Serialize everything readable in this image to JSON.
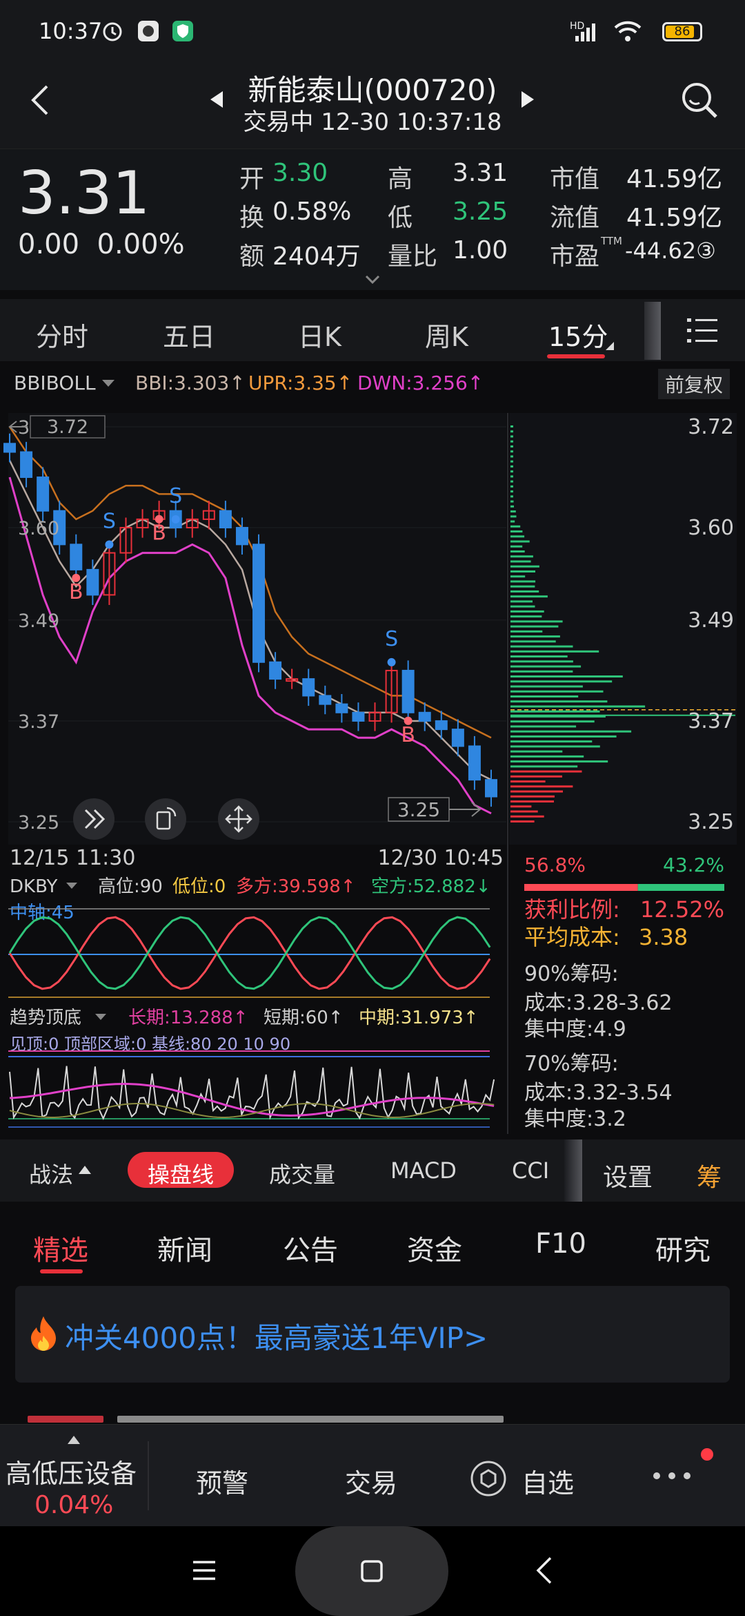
{
  "status": {
    "time": "10:37",
    "battery": "86",
    "battery_level": 0.86,
    "net_label": "HD"
  },
  "header": {
    "title": "新能泰山(000720)",
    "subtitle": "交易中   12-30 10:37:18"
  },
  "quote": {
    "price": "3.31",
    "change": "0.00",
    "change_pct": "0.00%",
    "open_label": "开",
    "open": "3.30",
    "high_label": "高",
    "high": "3.31",
    "mcap_label": "市值",
    "mcap": "41.59亿",
    "turnover_label": "换",
    "turnover": "0.58%",
    "low_label": "低",
    "low": "3.25",
    "float_label": "流值",
    "float_cap": "41.59亿",
    "amount_label": "额",
    "amount": "2404万",
    "volratio_label": "量比",
    "volratio": "1.00",
    "pe_label": "市盈",
    "pe_sup": "TTM",
    "pe": "-44.62③"
  },
  "tabs": [
    "分时",
    "五日",
    "日K",
    "周K",
    "15分"
  ],
  "active_tab": "15分",
  "indicator_main": {
    "name": "BBIBOLL",
    "bbi": "BBI:3.303↑",
    "upr": "UPR:3.35↑",
    "dwn": "DWN:3.256↑",
    "adjust": "前复权"
  },
  "main_chart": {
    "y_ticks": [
      "3.72",
      "3.60",
      "3.49",
      "3.37",
      "3.25"
    ],
    "ymax_box": "3.72",
    "ymin_box": "3.25",
    "x_start": "12/15 11:30",
    "x_end": "12/30 10:45",
    "marker_s": "S",
    "marker_b": "B"
  },
  "chips": {
    "profit_pct": "56.8%",
    "loss_pct": "43.2%",
    "profit_ratio_label": "获利比例:",
    "profit_ratio": "12.52%",
    "avg_cost_label": "平均成本:",
    "avg_cost": "3.38",
    "chip90_label": "90%筹码:",
    "chip90_cost": "成本:3.28-3.62",
    "chip90_conc": "集中度:4.9",
    "chip70_label": "70%筹码:",
    "chip70_cost": "成本:3.32-3.54",
    "chip70_conc": "集中度:3.2"
  },
  "dkby": {
    "name": "DKBY",
    "high": "高位:90",
    "low": "低位:0",
    "bull": "多方:39.598↑",
    "bear": "空方:52.882↓",
    "axis": "中轴:45"
  },
  "trend": {
    "name": "趋势顶底",
    "long": "长期:13.288↑",
    "short": "短期:60↑",
    "mid": "中期:31.973↑",
    "legend": "见顶:0 顶部区域:0 基线:80 20 10 90"
  },
  "strategy_bar": [
    "战法",
    "操盘线",
    "成交量",
    "MACD",
    "CCI",
    "设置",
    "筹"
  ],
  "news_tabs": [
    "精选",
    "新闻",
    "公告",
    "资金",
    "F10",
    "研究"
  ],
  "banner": {
    "text": "冲关4000点！最高豪送1年VIP>"
  },
  "bottom": {
    "sector": "高低压设备",
    "sector_pct": "0.04%",
    "alert": "预警",
    "trade": "交易",
    "watch": "自选"
  },
  "chart_data": {
    "type": "candlestick",
    "title": "",
    "xlabel": "",
    "ylabel": "",
    "ylim": [
      3.25,
      3.72
    ],
    "x_range": [
      "12/15 11:30",
      "12/30 10:45"
    ],
    "approx_close": [
      3.69,
      3.66,
      3.62,
      3.58,
      3.55,
      3.52,
      3.57,
      3.6,
      3.61,
      3.62,
      3.6,
      3.61,
      3.62,
      3.6,
      3.58,
      3.44,
      3.42,
      3.42,
      3.4,
      3.39,
      3.38,
      3.37,
      3.38,
      3.43,
      3.38,
      3.37,
      3.36,
      3.34,
      3.3,
      3.28
    ],
    "bbi": [
      3.68,
      3.64,
      3.6,
      3.56,
      3.53,
      3.55,
      3.58,
      3.6,
      3.61,
      3.6,
      3.6,
      3.61,
      3.6,
      3.58,
      3.55,
      3.48,
      3.44,
      3.42,
      3.41,
      3.4,
      3.39,
      3.38,
      3.38,
      3.38,
      3.37,
      3.37,
      3.35,
      3.33,
      3.31,
      3.3
    ],
    "upr": [
      3.72,
      3.69,
      3.67,
      3.63,
      3.61,
      3.62,
      3.64,
      3.65,
      3.65,
      3.64,
      3.64,
      3.64,
      3.63,
      3.62,
      3.6,
      3.56,
      3.5,
      3.47,
      3.45,
      3.44,
      3.43,
      3.42,
      3.41,
      3.4,
      3.4,
      3.39,
      3.38,
      3.37,
      3.36,
      3.35
    ],
    "dwn": [
      3.66,
      3.59,
      3.52,
      3.47,
      3.44,
      3.5,
      3.54,
      3.56,
      3.57,
      3.57,
      3.57,
      3.58,
      3.57,
      3.54,
      3.46,
      3.4,
      3.38,
      3.37,
      3.36,
      3.36,
      3.36,
      3.35,
      3.35,
      3.36,
      3.35,
      3.34,
      3.32,
      3.3,
      3.27,
      3.26
    ]
  }
}
